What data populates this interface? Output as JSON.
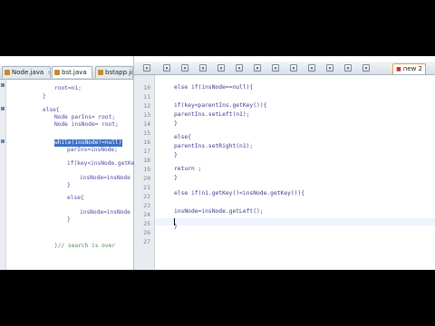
{
  "left_editor": {
    "tabs": [
      {
        "label": "Node.java",
        "active": false
      },
      {
        "label": "bst.java",
        "active": true
      },
      {
        "label": "bstapp.java",
        "active": false
      }
    ],
    "lines": [
      "root=n1;",
      "}",
      "else{",
      "Node parIns= root;",
      "Node insNode= root;",
      "while(insNode!=null)",
      "parIns=insNode;",
      "if(key<insNode.getKey",
      "insNode=insNode",
      "}",
      "else{",
      "insNode=insNode",
      "}",
      "}// search is over"
    ]
  },
  "right_editor": {
    "tab_label": "new  2",
    "line_numbers": [
      "10",
      "11",
      "12",
      "13",
      "14",
      "15",
      "16",
      "17",
      "18",
      "19",
      "20",
      "21",
      "22",
      "23",
      "24",
      "25",
      "26",
      "27"
    ],
    "lines": [
      "else if(insNode==null){",
      "",
      "if(key<parentIns.getKey()){",
      "parentIns.setLeft(n1);",
      "}",
      "else{",
      "parentIns.setRight(n1);",
      "}",
      "return ;",
      "}",
      "",
      "else if(n1.getKey()<insNode.getKey()){",
      "",
      "insNode=insNode.getLeft();",
      "",
      "}",
      "",
      ""
    ]
  }
}
